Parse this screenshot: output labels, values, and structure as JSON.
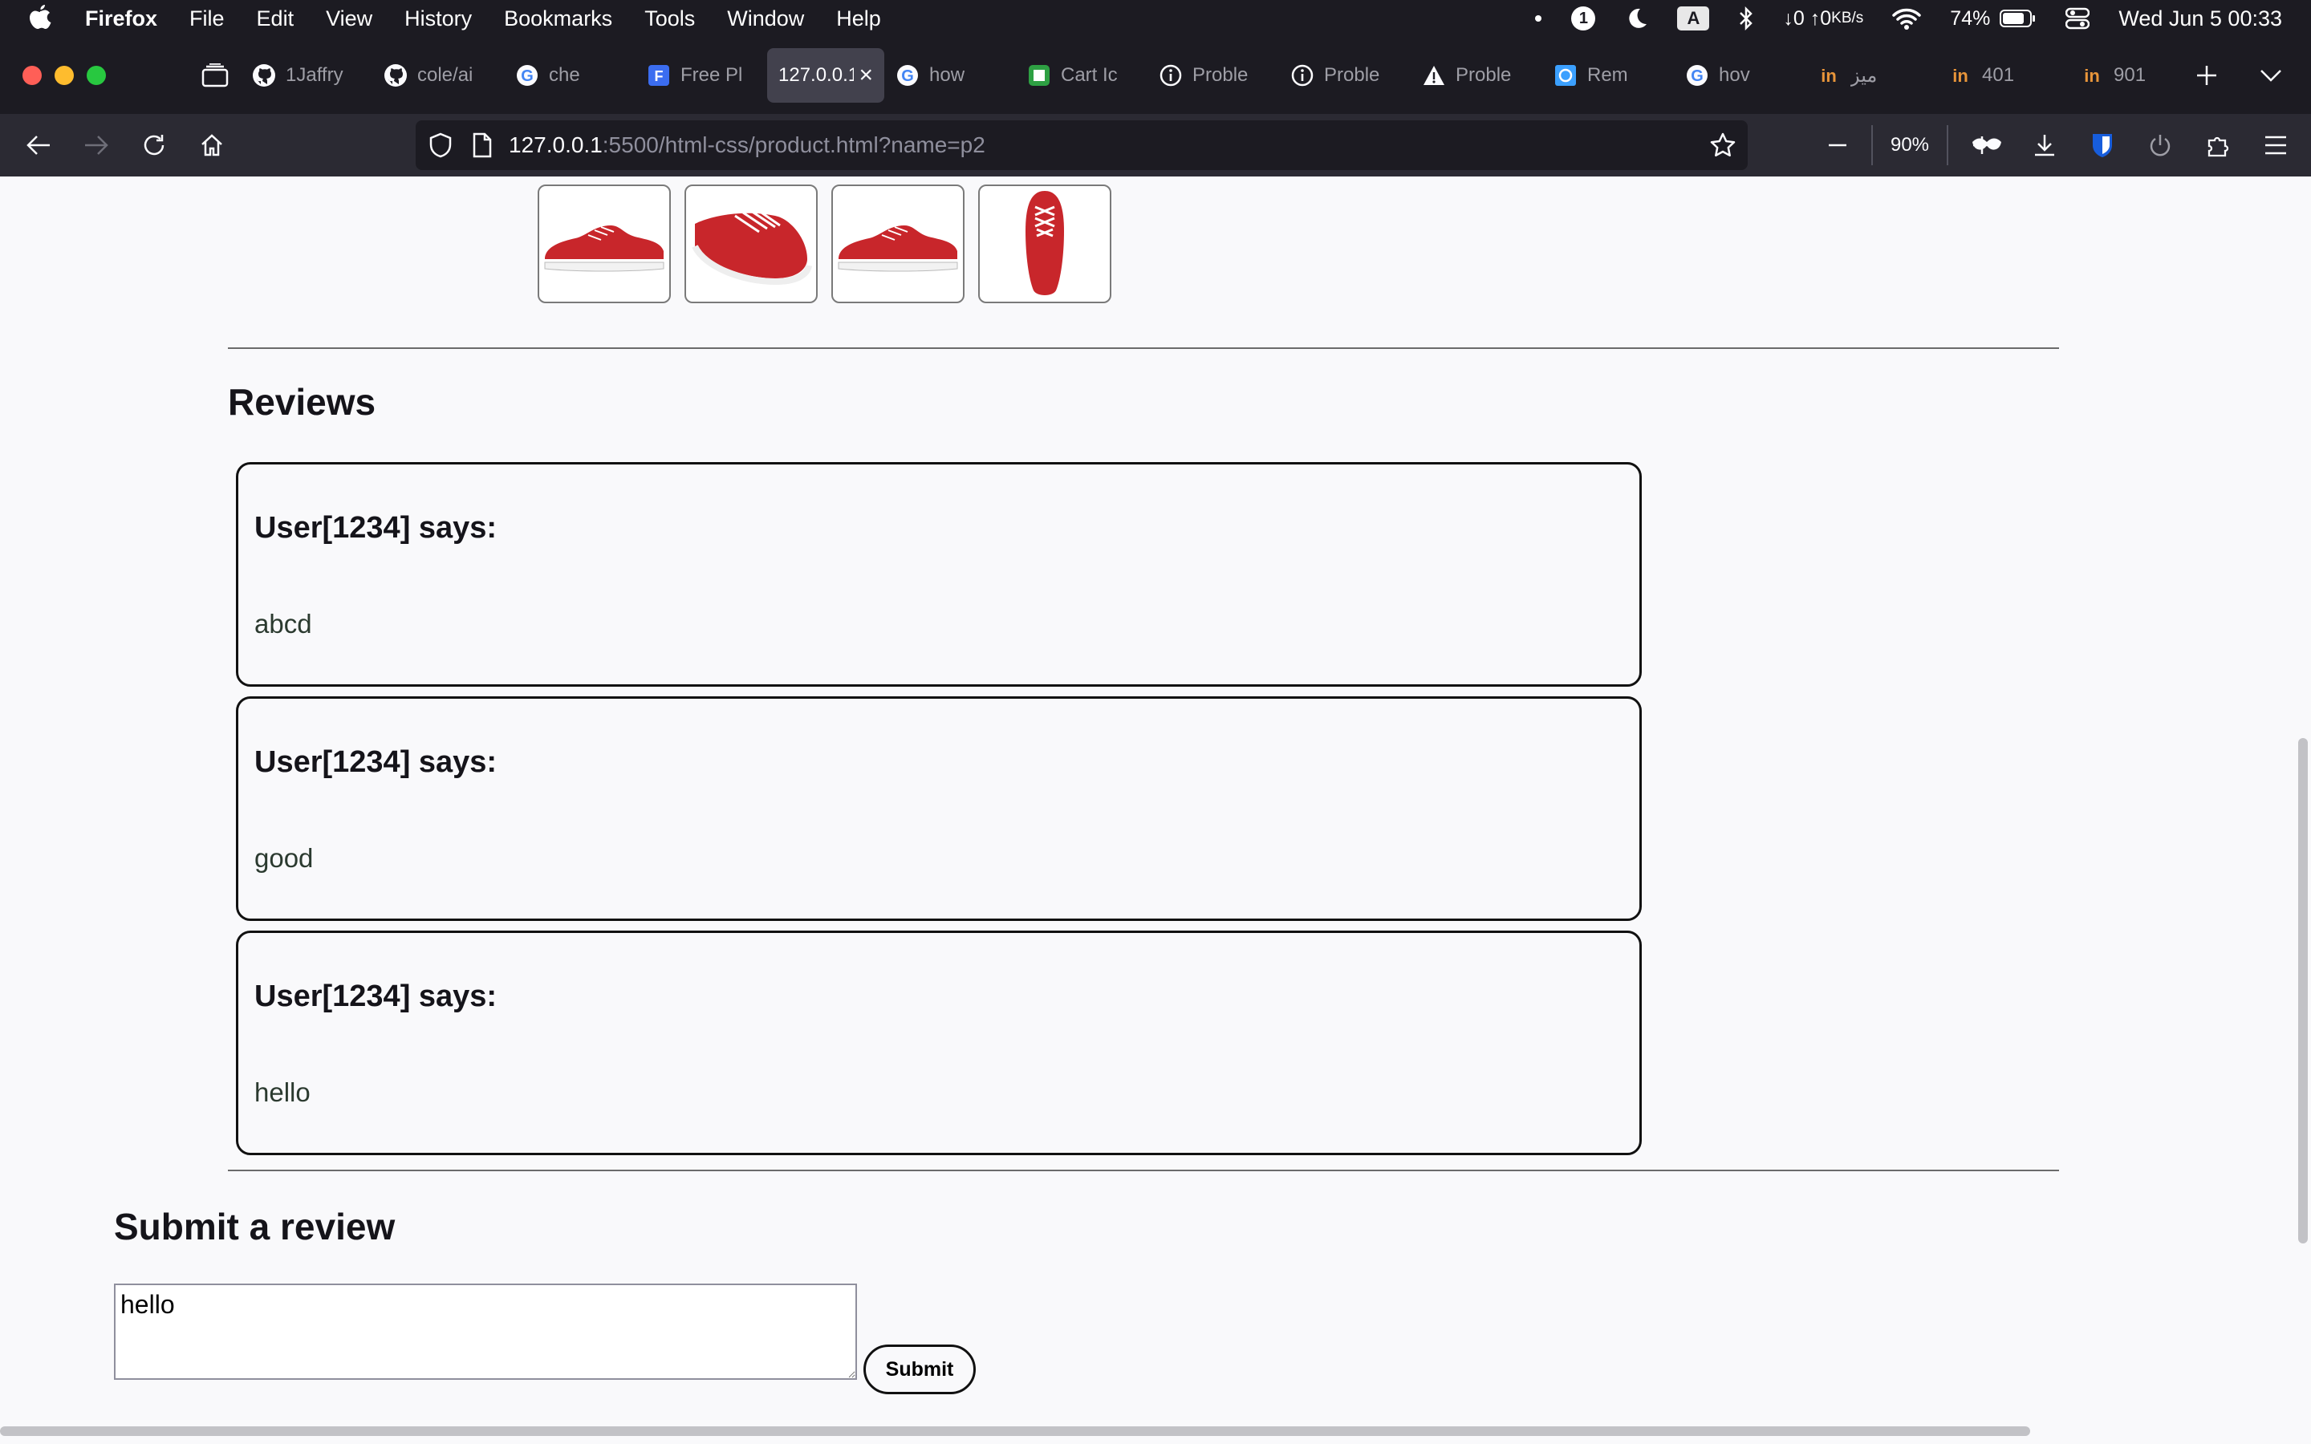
{
  "menubar": {
    "app_name": "Firefox",
    "items": [
      "File",
      "Edit",
      "View",
      "History",
      "Bookmarks",
      "Tools",
      "Window",
      "Help"
    ],
    "status": {
      "onepassword_badge": "1",
      "input_source": "A",
      "net_down": "↓0",
      "net_up": "↑0",
      "net_unit": "KB/s",
      "battery": "74%",
      "datetime": "Wed Jun 5  00:33"
    }
  },
  "tabs": [
    {
      "label": "1Jaffry",
      "icon": "github-icon"
    },
    {
      "label": "cole/ai",
      "icon": "github-icon"
    },
    {
      "label": "che",
      "icon": "google-icon"
    },
    {
      "label": "Free Pl",
      "icon": "freepik-icon"
    },
    {
      "label": "127.0.0.1",
      "icon": "none",
      "active": true
    },
    {
      "label": "how",
      "icon": "google-icon"
    },
    {
      "label": "Cart Ic",
      "icon": "cart-site-icon"
    },
    {
      "label": "Proble",
      "icon": "info-icon"
    },
    {
      "label": "Proble",
      "icon": "info-icon"
    },
    {
      "label": "Proble",
      "icon": "warning-icon"
    },
    {
      "label": "Rem",
      "icon": "site-icon"
    },
    {
      "label": "hov",
      "icon": "google-icon"
    },
    {
      "label": "میز",
      "icon": "site-icon"
    },
    {
      "label": "401",
      "icon": "site-icon"
    },
    {
      "label": "901",
      "icon": "site-icon"
    }
  ],
  "navbar": {
    "url_host": "127.0.0.1",
    "url_path": ":5500/html-css/product.html?name=p2",
    "zoom": "90%"
  },
  "page": {
    "reviews_heading": "Reviews",
    "reviews": [
      {
        "author": "User[1234] says:",
        "text": "abcd"
      },
      {
        "author": "User[1234] says:",
        "text": "good"
      },
      {
        "author": "User[1234] says:",
        "text": "hello"
      }
    ],
    "submit_heading": "Submit a review",
    "review_input_value": "hello",
    "submit_label": "Submit",
    "thumbnails": [
      "red-sneaker-side",
      "red-sneaker-angle",
      "red-sneaker-side-2",
      "red-sneaker-top"
    ]
  },
  "colors": {
    "chrome_dark": "#1c1b22",
    "toolbar": "#2b2a33",
    "page_bg": "#f9f9fb",
    "sneaker_red": "#c8262b"
  }
}
